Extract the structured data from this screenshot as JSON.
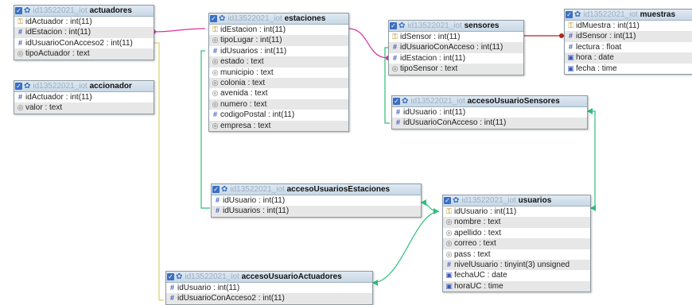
{
  "colors": {
    "link_pink": "#d6339c",
    "link_red": "#b0261f",
    "link_yellow": "#d7d36a",
    "link_green": "#2cbf7a",
    "header_icon": "#3b6fc2"
  },
  "tables": [
    {
      "id": "actuadores",
      "prefix": "id13522021_iot",
      "name": "actuadores",
      "columns": [
        {
          "icon": "key-icon",
          "text": "idActuador : int(11)"
        },
        {
          "icon": "number-icon",
          "text": "idEstacion : int(11)"
        },
        {
          "icon": "number-icon",
          "text": "idUsuarioConAcceso2 : int(11)"
        },
        {
          "icon": "text-icon",
          "text": "tipoActuador : text"
        }
      ]
    },
    {
      "id": "accionador",
      "prefix": "id13522021_iot",
      "name": "accionador",
      "columns": [
        {
          "icon": "number-icon",
          "text": "idActuador : int(11)"
        },
        {
          "icon": "text-icon",
          "text": "valor : text"
        }
      ]
    },
    {
      "id": "estaciones",
      "prefix": "id13522021_iot",
      "name": "estaciones",
      "columns": [
        {
          "icon": "key-icon",
          "text": "idEstacion : int(11)"
        },
        {
          "icon": "text-icon",
          "text": "tipoLugar : int(11)"
        },
        {
          "icon": "number-icon",
          "text": "idUsuarios : int(11)"
        },
        {
          "icon": "text-icon",
          "text": "estado : text"
        },
        {
          "icon": "text-icon",
          "text": "municipio : text"
        },
        {
          "icon": "text-icon",
          "text": "colonia : text"
        },
        {
          "icon": "text-icon",
          "text": "avenida : text"
        },
        {
          "icon": "text-icon",
          "text": "numero : text"
        },
        {
          "icon": "number-icon",
          "text": "codigoPostal : int(11)"
        },
        {
          "icon": "text-icon",
          "text": "empresa : text"
        }
      ]
    },
    {
      "id": "sensores",
      "prefix": "id13522021_iot",
      "name": "sensores",
      "columns": [
        {
          "icon": "key-icon",
          "text": "idSensor : int(11)"
        },
        {
          "icon": "number-icon",
          "text": "idUsuarioConAcceso : int(11)"
        },
        {
          "icon": "number-icon",
          "text": "idEstacion : int(11)"
        },
        {
          "icon": "text-icon",
          "text": "tipoSensor : text"
        }
      ]
    },
    {
      "id": "muestras",
      "prefix": "id13522021_iot",
      "name": "muestras",
      "columns": [
        {
          "icon": "key-icon",
          "text": "idMuestra : int(11)"
        },
        {
          "icon": "number-icon",
          "text": "idSensor : int(11)"
        },
        {
          "icon": "number-icon",
          "text": "lectura : float"
        },
        {
          "icon": "date-icon",
          "text": "hora : date"
        },
        {
          "icon": "date-icon",
          "text": "fecha : time"
        }
      ]
    },
    {
      "id": "accesoUsuarioSensores",
      "prefix": "id13522021_iot",
      "name": "accesoUsuarioSensores",
      "columns": [
        {
          "icon": "number-icon",
          "text": "idUsuario : int(11)"
        },
        {
          "icon": "number-icon",
          "text": "idUsuarioConAcceso : int(11)"
        }
      ]
    },
    {
      "id": "accesoUsuariosEstaciones",
      "prefix": "id13522021_iot",
      "name": "accesoUsuariosEstaciones",
      "columns": [
        {
          "icon": "number-icon",
          "text": "idUsuario : int(11)"
        },
        {
          "icon": "number-icon",
          "text": "idUsuarios : int(11)"
        }
      ]
    },
    {
      "id": "usuarios",
      "prefix": "id13522021_iot",
      "name": "usuarios",
      "columns": [
        {
          "icon": "key-icon",
          "text": "idUsuario : int(11)"
        },
        {
          "icon": "text-icon",
          "text": "nombre : text"
        },
        {
          "icon": "text-icon",
          "text": "apellido : text"
        },
        {
          "icon": "text-icon",
          "text": "correo : text"
        },
        {
          "icon": "text-icon",
          "text": "pass : text"
        },
        {
          "icon": "number-icon",
          "text": "nivelUsuario : tinyint(3) unsigned"
        },
        {
          "icon": "date-icon",
          "text": "fechaUC : date"
        },
        {
          "icon": "date-icon",
          "text": "horaUC : time"
        }
      ]
    },
    {
      "id": "accesoUsuarioActuadores",
      "prefix": "id13522021_iot",
      "name": "accesoUsuarioActuadores",
      "columns": [
        {
          "icon": "number-icon",
          "text": "idUsuario : int(11)"
        },
        {
          "icon": "number-icon",
          "text": "idUsuarioConAcceso2 : int(11)"
        }
      ]
    }
  ]
}
